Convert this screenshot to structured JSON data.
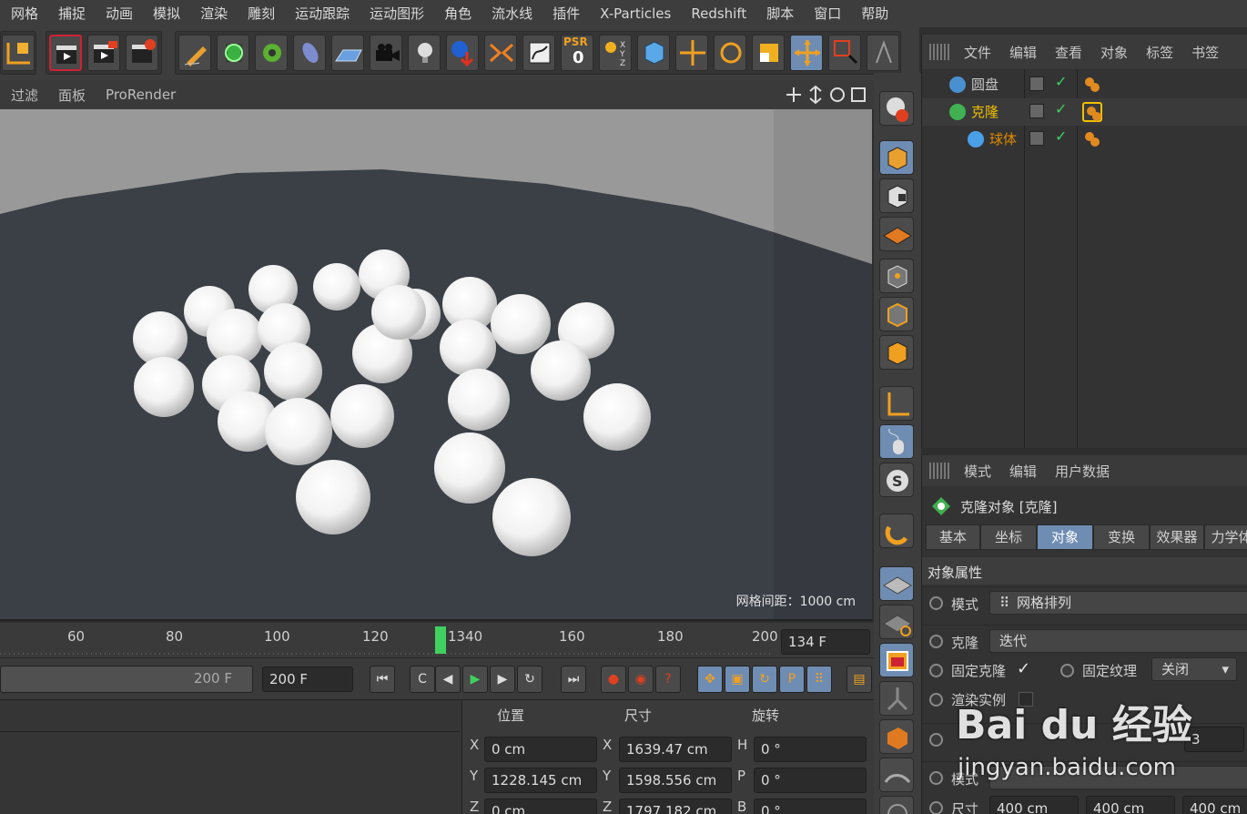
{
  "menu": [
    "网格",
    "捕捉",
    "动画",
    "模拟",
    "渲染",
    "雕刻",
    "运动跟踪",
    "运动图形",
    "角色",
    "流水线",
    "插件",
    "X-Particles",
    "Redshift",
    "脚本",
    "窗口",
    "帮助"
  ],
  "viewport": {
    "menus": [
      "过滤",
      "面板",
      "ProRender"
    ],
    "grid_spacing": "网格间距：1000 cm"
  },
  "toolbar": {
    "psr_label": "PSR",
    "psr_value": "0"
  },
  "timeline": {
    "ticks": [
      "60",
      "80",
      "100",
      "120",
      "1340",
      "160",
      "180",
      "200"
    ],
    "current_frame": "134 F",
    "range_end": "200 F",
    "end_frame": "200 F"
  },
  "coords": {
    "headers": [
      "位置",
      "尺寸",
      "旋转"
    ],
    "rows": [
      {
        "axis": "X",
        "pos": "0 cm",
        "size_axis": "X",
        "size": "1639.47 cm",
        "rot_axis": "H",
        "rot": "0 °"
      },
      {
        "axis": "Y",
        "pos": "1228.145 cm",
        "size_axis": "Y",
        "size": "1598.556 cm",
        "rot_axis": "P",
        "rot": "0 °"
      },
      {
        "axis": "Z",
        "pos": "0 cm",
        "size_axis": "Z",
        "size": "1797.182 cm",
        "rot_axis": "B",
        "rot": "0 °"
      }
    ]
  },
  "objmgr": {
    "menu": [
      "文件",
      "编辑",
      "查看",
      "对象",
      "标签",
      "书签"
    ],
    "items": [
      {
        "name": "圆盘",
        "color": "#c8c8c8"
      },
      {
        "name": "克隆",
        "color": "#f0c000"
      },
      {
        "name": "球体",
        "color": "#e08a00"
      }
    ]
  },
  "attr": {
    "menu": [
      "模式",
      "编辑",
      "用户数据"
    ],
    "title": "克隆对象 [克隆]",
    "tabs": [
      "基本",
      "坐标",
      "对象",
      "变换",
      "效果器",
      "力学体"
    ],
    "section": "对象属性",
    "mode_label": "模式",
    "mode_value": "网格排列",
    "clone_label": "克隆",
    "clone_value": "迭代",
    "fix_clone_label": "固定克隆",
    "fix_texture_label": "固定纹理",
    "fix_texture_value": "关闭",
    "render_instance_label": "渲染实例",
    "count_value": "3",
    "mode2_label": "模式",
    "size_label": "尺寸",
    "size_values": [
      "400 cm",
      "400 cm",
      "400 cm"
    ]
  },
  "watermark": {
    "brand": "Bai du 经验",
    "url": "jingyan.baidu.com"
  }
}
